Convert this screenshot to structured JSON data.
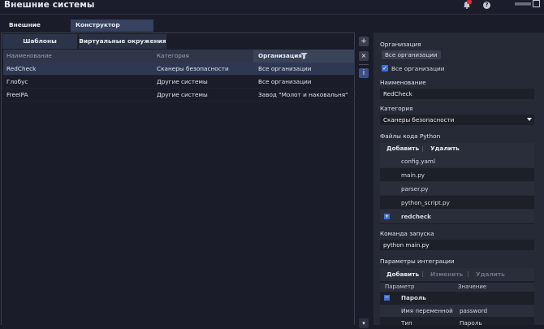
{
  "header": {
    "title": "Внешние системы",
    "help_glyph": "?"
  },
  "main_tabs": [
    {
      "label": "Внешние системы"
    },
    {
      "label": "Конструктор интеграций"
    }
  ],
  "sub_tabs": [
    {
      "label": "Шаблоны интеграций"
    },
    {
      "label": "Виртуальные окружения"
    }
  ],
  "grid": {
    "columns": [
      "Наименование",
      "Категория",
      "Организация"
    ],
    "rows": [
      {
        "name": "RedCheck",
        "category": "Сканеры безопасности",
        "org": "Все организации"
      },
      {
        "name": "Глобус",
        "category": "Другие системы",
        "org": "Все организации"
      },
      {
        "name": "FreeIPA",
        "category": "Другие системы",
        "org": "Завод \"Молот и наковальня\""
      }
    ]
  },
  "side_buttons": {
    "add": "+",
    "remove": "×",
    "info": "i",
    "bottom": "▾"
  },
  "form": {
    "org_label": "Организация",
    "org_chip": "Все организации",
    "all_orgs_checkbox": "Все организации",
    "name_label": "Наименование",
    "name_value": "RedCheck",
    "category_label": "Категория",
    "category_value": "Сканеры безопасности",
    "files_label": "Файлы кода Python",
    "files_add": "Добавить",
    "files_delete": "Удалить",
    "files": [
      "config.yaml",
      "main.py",
      "parser.py",
      "python_script.py"
    ],
    "folder": "redcheck",
    "command_label": "Команда запуска",
    "command_value": "python main.py",
    "params_label": "Параметры интеграции",
    "params_add": "Добавить",
    "params_edit": "Изменить",
    "params_delete": "Удалить",
    "params_col_param": "Параметр",
    "params_col_value": "Значение",
    "params_group": "Пароль",
    "params_rows": [
      {
        "param": "Имя переменной",
        "value": "password"
      },
      {
        "param": "Тип",
        "value": "Пароль"
      }
    ]
  },
  "colors": {
    "accent": "#3d6ed8",
    "badge": "#e0283a",
    "selected_row": "#2f3853"
  }
}
